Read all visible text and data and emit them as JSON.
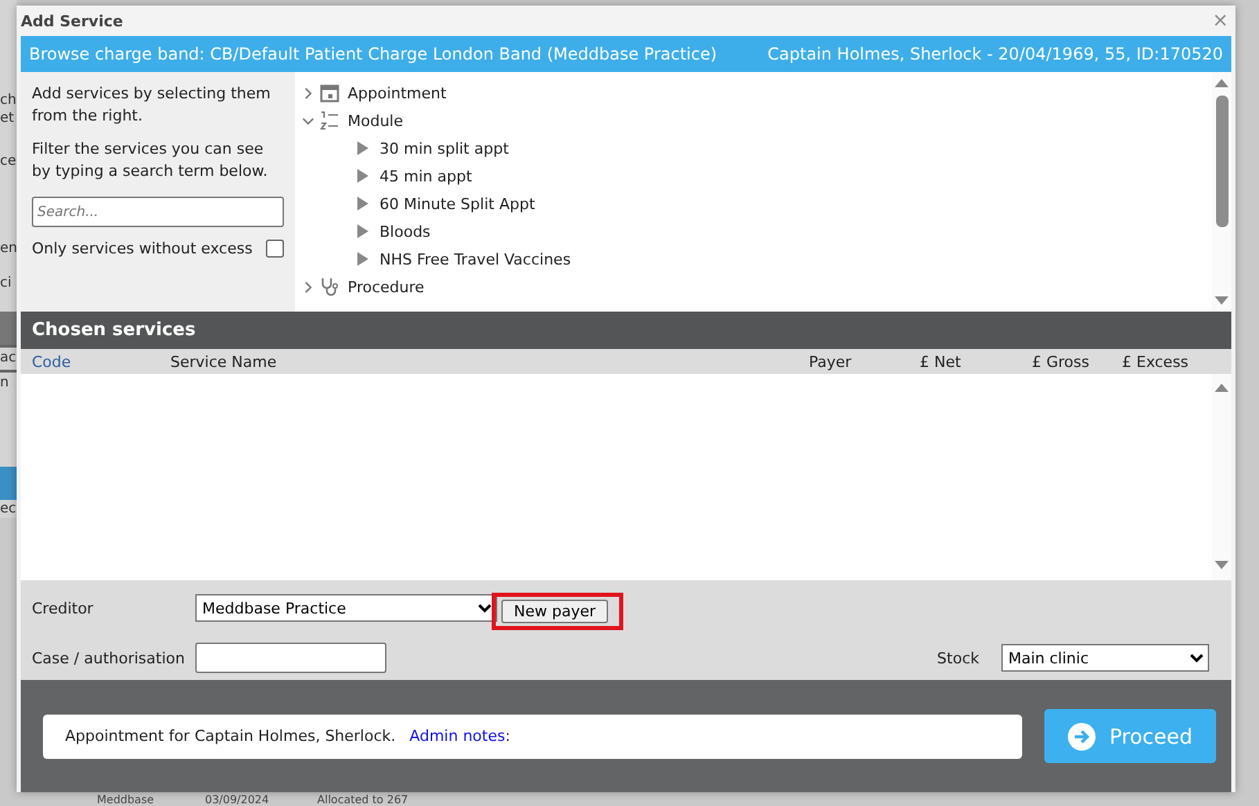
{
  "background": {
    "side_fragments": [
      "ch",
      "et",
      "ce",
      "en",
      "ci",
      "ac",
      "n",
      "ec"
    ],
    "bottom_row": [
      "Meddbase",
      "03/09/2024",
      "Allocated to 267"
    ]
  },
  "dialog": {
    "title": "Add Service",
    "close": "×"
  },
  "header": {
    "charge_band": "Browse charge band: CB/Default Patient Charge London Band (Meddbase Practice)",
    "patient": "Captain Holmes, Sherlock - 20/04/1969, 55, ID:170520"
  },
  "filter_panel": {
    "intro": "Add services by selecting them from the right.",
    "hint": "Filter the services you can see by typing a search term below.",
    "search": {
      "placeholder": "Search..."
    },
    "excess_filter": {
      "label": "Only services without excess",
      "checked": false
    }
  },
  "tree": [
    {
      "label": "Appointment",
      "expanded": false
    },
    {
      "label": "Module",
      "expanded": true,
      "children": [
        {
          "label": "30 min split appt"
        },
        {
          "label": "45 min appt"
        },
        {
          "label": "60 Minute Split Appt"
        },
        {
          "label": "Bloods"
        },
        {
          "label": "NHS Free Travel Vaccines"
        }
      ]
    },
    {
      "label": "Procedure",
      "expanded": false
    }
  ],
  "chosen_services": {
    "title": "Chosen services",
    "columns": [
      "Code",
      "Service Name",
      "Payer",
      "£ Net",
      "£ Gross",
      "£ Excess"
    ]
  },
  "form": {
    "creditor": {
      "label": "Creditor",
      "value": "Meddbase Practice"
    },
    "new_payer": "New payer",
    "case": {
      "label": "Case / authorisation"
    },
    "stock": {
      "label": "Stock",
      "value": "Main clinic"
    }
  },
  "footer": {
    "note": "Appointment for Captain Holmes, Sherlock.",
    "admin_link": "Admin notes",
    "admin_colon": ":",
    "proceed": "Proceed"
  }
}
